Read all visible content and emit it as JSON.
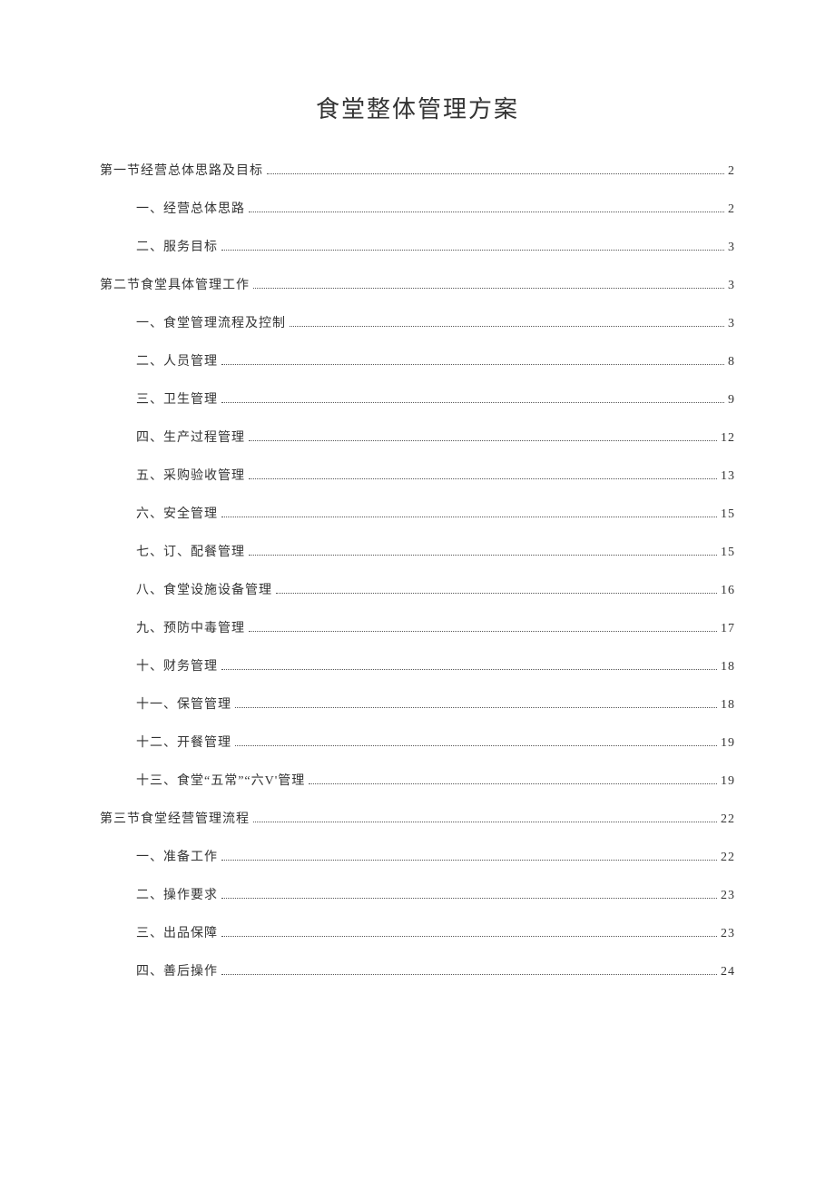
{
  "title": "食堂整体管理方案",
  "toc": [
    {
      "level": 1,
      "label": "第一节经营总体思路及目标",
      "page": "2"
    },
    {
      "level": 2,
      "label": "一、经营总体思路",
      "page": "2"
    },
    {
      "level": 2,
      "label": "二、服务目标",
      "page": "3"
    },
    {
      "level": 1,
      "label": "第二节食堂具体管理工作",
      "page": "3"
    },
    {
      "level": 2,
      "label": "一、食堂管理流程及控制",
      "page": "3"
    },
    {
      "level": 2,
      "label": "二、人员管理",
      "page": "8"
    },
    {
      "level": 2,
      "label": "三、卫生管理",
      "page": "9"
    },
    {
      "level": 2,
      "label": "四、生产过程管理",
      "page": "12"
    },
    {
      "level": 2,
      "label": "五、采购验收管理",
      "page": "13"
    },
    {
      "level": 2,
      "label": "六、安全管理",
      "page": "15"
    },
    {
      "level": 2,
      "label": "七、订、配餐管理",
      "page": "15"
    },
    {
      "level": 2,
      "label": "八、食堂设施设备管理",
      "page": "16"
    },
    {
      "level": 2,
      "label": "九、预防中毒管理",
      "page": "17"
    },
    {
      "level": 2,
      "label": "十、财务管理",
      "page": "18"
    },
    {
      "level": 2,
      "label": "十一、保管管理",
      "page": "18"
    },
    {
      "level": 2,
      "label": "十二、开餐管理",
      "page": "19"
    },
    {
      "level": 2,
      "label": "十三、食堂“五常”“六V'管理",
      "page": "19"
    },
    {
      "level": 1,
      "label": "第三节食堂经营管理流程",
      "page": "22"
    },
    {
      "level": 2,
      "label": "一、准备工作",
      "page": "22"
    },
    {
      "level": 2,
      "label": "二、操作要求",
      "page": "23"
    },
    {
      "level": 2,
      "label": "三、出品保障",
      "page": "23"
    },
    {
      "level": 2,
      "label": "四、善后操作",
      "page": "24"
    }
  ]
}
